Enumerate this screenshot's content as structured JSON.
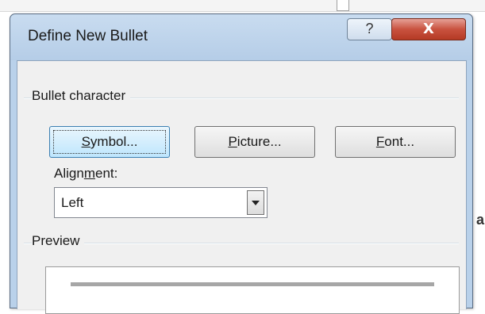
{
  "dialog": {
    "title": "Define New Bullet",
    "help_label": "?",
    "close_label": "X"
  },
  "bullet_character": {
    "group_label": "Bullet character",
    "symbol_button": {
      "mnemonic": "S",
      "rest": "ymbol..."
    },
    "picture_button": {
      "mnemonic": "P",
      "rest": "icture..."
    },
    "font_button": {
      "mnemonic": "F",
      "rest": "ont..."
    }
  },
  "alignment": {
    "label_before": "Align",
    "label_mnemonic": "m",
    "label_after": "ent:",
    "selected": "Left"
  },
  "preview": {
    "group_label": "Preview"
  },
  "colors": {
    "title_bg": "#b9d1ea",
    "close_red": "#c9523f",
    "client_bg": "#f0f0f0"
  },
  "icons": [
    "help-icon",
    "close-icon",
    "dropdown-arrow-icon"
  ]
}
